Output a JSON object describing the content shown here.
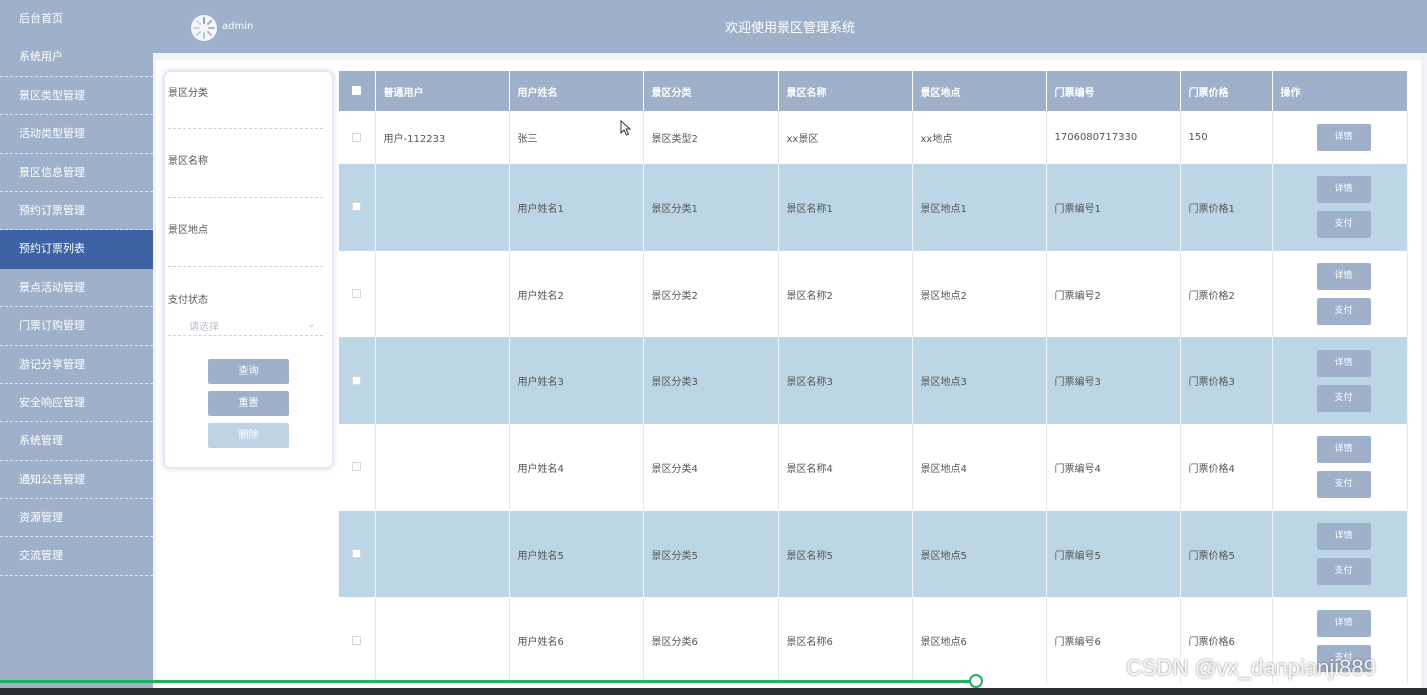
{
  "sidebar": {
    "items": [
      {
        "label": "后台首页"
      },
      {
        "label": "系统用户"
      },
      {
        "label": "景区类型管理"
      },
      {
        "label": "活动类型管理"
      },
      {
        "label": "景区信息管理"
      },
      {
        "label": "预约订票管理"
      },
      {
        "label": "预约订票列表"
      },
      {
        "label": "景点活动管理"
      },
      {
        "label": "门票订购管理"
      },
      {
        "label": "游记分享管理"
      },
      {
        "label": "安全响应管理"
      },
      {
        "label": "系统管理"
      },
      {
        "label": "通知公告管理"
      },
      {
        "label": "资源管理"
      },
      {
        "label": "交流管理"
      }
    ],
    "active_index": 6
  },
  "header": {
    "username": "admin",
    "title": "欢迎使用景区管理系统"
  },
  "filter": {
    "category_label": "景区分类",
    "name_label": "景区名称",
    "location_label": "景区地点",
    "pay_status_label": "支付状态",
    "pay_status_placeholder": "请选择",
    "query_button": "查询",
    "reset_button": "重置",
    "delete_button": "删除"
  },
  "table": {
    "columns": [
      "普通用户",
      "用户姓名",
      "景区分类",
      "景区名称",
      "景区地点",
      "门票编号",
      "门票价格",
      "操作"
    ],
    "detail_label": "详情",
    "pay_label": "支付",
    "rows": [
      {
        "user": "用户-112233",
        "name": "张三",
        "category": "景区类型2",
        "scenic": "xx景区",
        "location": "xx地点",
        "ticket_no": "1706080717330",
        "price": "150",
        "payable": false
      },
      {
        "user": "",
        "name": "用户姓名1",
        "category": "景区分类1",
        "scenic": "景区名称1",
        "location": "景区地点1",
        "ticket_no": "门票编号1",
        "price": "门票价格1",
        "payable": true
      },
      {
        "user": "",
        "name": "用户姓名2",
        "category": "景区分类2",
        "scenic": "景区名称2",
        "location": "景区地点2",
        "ticket_no": "门票编号2",
        "price": "门票价格2",
        "payable": true
      },
      {
        "user": "",
        "name": "用户姓名3",
        "category": "景区分类3",
        "scenic": "景区名称3",
        "location": "景区地点3",
        "ticket_no": "门票编号3",
        "price": "门票价格3",
        "payable": true
      },
      {
        "user": "",
        "name": "用户姓名4",
        "category": "景区分类4",
        "scenic": "景区名称4",
        "location": "景区地点4",
        "ticket_no": "门票编号4",
        "price": "门票价格4",
        "payable": true
      },
      {
        "user": "",
        "name": "用户姓名5",
        "category": "景区分类5",
        "scenic": "景区名称5",
        "location": "景区地点5",
        "ticket_no": "门票编号5",
        "price": "门票价格5",
        "payable": true
      },
      {
        "user": "",
        "name": "用户姓名6",
        "category": "景区分类6",
        "scenic": "景区名称6",
        "location": "景区地点6",
        "ticket_no": "门票编号6",
        "price": "门票价格6",
        "payable": true
      }
    ]
  },
  "watermark": "CSDN @vx_danpianji889",
  "colors": {
    "primary": "#9fb0cb",
    "active": "#3d63a5",
    "row_highlight": "#bdd6e6",
    "progress": "#21b15a"
  }
}
